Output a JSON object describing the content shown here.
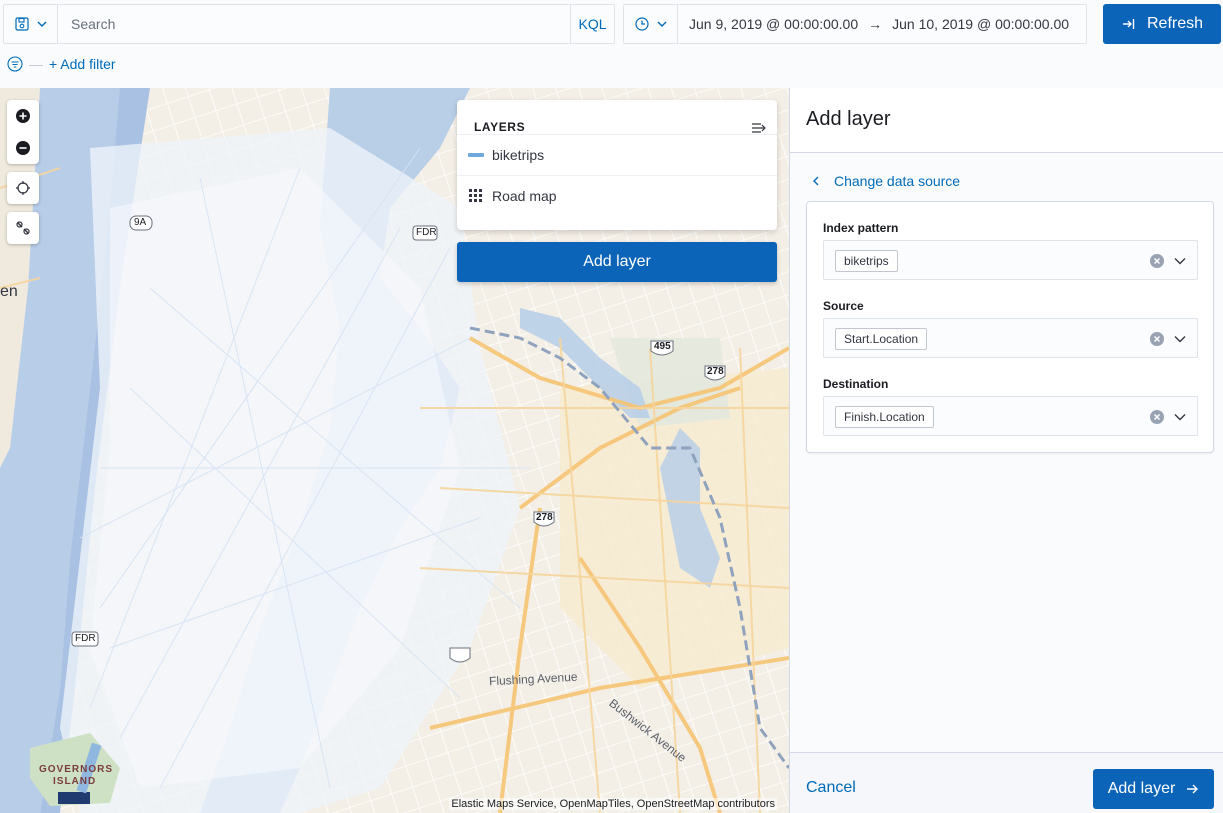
{
  "query_bar": {
    "search_placeholder": "Search",
    "language_toggle": "KQL",
    "date_start": "Jun 9, 2019 @ 00:00:00.00",
    "date_arrow": "→",
    "date_end": "Jun 10, 2019 @ 00:00:00.00",
    "refresh_label": "Refresh"
  },
  "filters": {
    "dash": "—",
    "add_filter_label": "+ Add filter"
  },
  "map": {
    "layers_panel": {
      "title": "LAYERS",
      "layers": [
        {
          "label": "biketrips",
          "icon": "line-swatch-icon",
          "color": "#6fa8dc"
        },
        {
          "label": "Road map",
          "icon": "grid-icon"
        }
      ]
    },
    "add_layer_button": "Add layer",
    "attribution": "Elastic Maps Service, OpenMapTiles, OpenStreetMap contributors",
    "labels": {
      "governors": "GOVERNORS",
      "island": "ISLAND",
      "flushing": "Flushing Avenue",
      "bushwick": "Bushwick Avenue",
      "fdr_top": "FDR",
      "fdr_bottom": "FDR",
      "i495": "495",
      "i278a": "278",
      "i278b": "278",
      "r9a": "9A",
      "edge_text": "en"
    }
  },
  "flyout": {
    "title": "Add layer",
    "change_source_label": "Change data source",
    "fields": [
      {
        "label": "Index pattern",
        "value": "biketrips"
      },
      {
        "label": "Source",
        "value": "Start.Location"
      },
      {
        "label": "Destination",
        "value": "Finish.Location"
      }
    ],
    "cancel_label": "Cancel",
    "submit_label": "Add layer"
  },
  "colors": {
    "primary": "#0b64b8",
    "link": "#006bb8",
    "water": "#b9cfe8",
    "trips": "#dbe7f5"
  }
}
